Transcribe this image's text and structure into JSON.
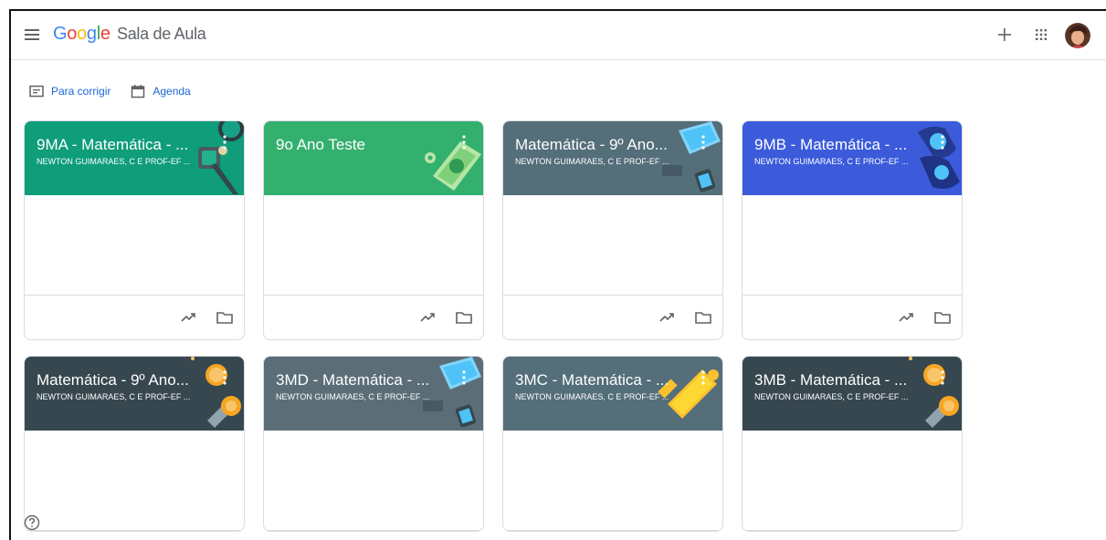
{
  "app": {
    "logo_letters": [
      "G",
      "o",
      "o",
      "g",
      "l",
      "e"
    ],
    "product_name": "Sala de Aula"
  },
  "quicklinks": {
    "to_review": "Para corrigir",
    "calendar": "Agenda"
  },
  "classes": [
    {
      "title": "9MA - Matemática - ...",
      "subtitle": "NEWTON GUIMARAES, C E PROF-EF ...",
      "color": "#0f9d7a"
    },
    {
      "title": "9o Ano Teste",
      "subtitle": "",
      "color": "#33b06e"
    },
    {
      "title": "Matemática - 9º Ano...",
      "subtitle": "NEWTON GUIMARAES, C E PROF-EF ...",
      "color": "#546e7a"
    },
    {
      "title": "9MB - Matemática - ...",
      "subtitle": "NEWTON GUIMARAES, C E PROF-EF ...",
      "color": "#3b5bdb"
    },
    {
      "title": "Matemática - 9º Ano...",
      "subtitle": "NEWTON GUIMARAES, C E PROF-EF ...",
      "color": "#37474f"
    },
    {
      "title": "3MD - Matemática - ...",
      "subtitle": "NEWTON GUIMARAES, C E PROF-EF ...",
      "color": "#5b6e78"
    },
    {
      "title": "3MC - Matemática - ...",
      "subtitle": "NEWTON GUIMARAES, C E PROF-EF ...",
      "color": "#546e7a"
    },
    {
      "title": "3MB - Matemática - ...",
      "subtitle": "NEWTON GUIMARAES, C E PROF-EF ...",
      "color": "#37474f"
    }
  ],
  "icons": {
    "menu": "menu-icon",
    "create": "plus-icon",
    "apps": "apps-grid-icon",
    "account": "avatar",
    "help": "help-icon",
    "progress": "trending-up-icon",
    "drive_folder": "folder-icon"
  }
}
